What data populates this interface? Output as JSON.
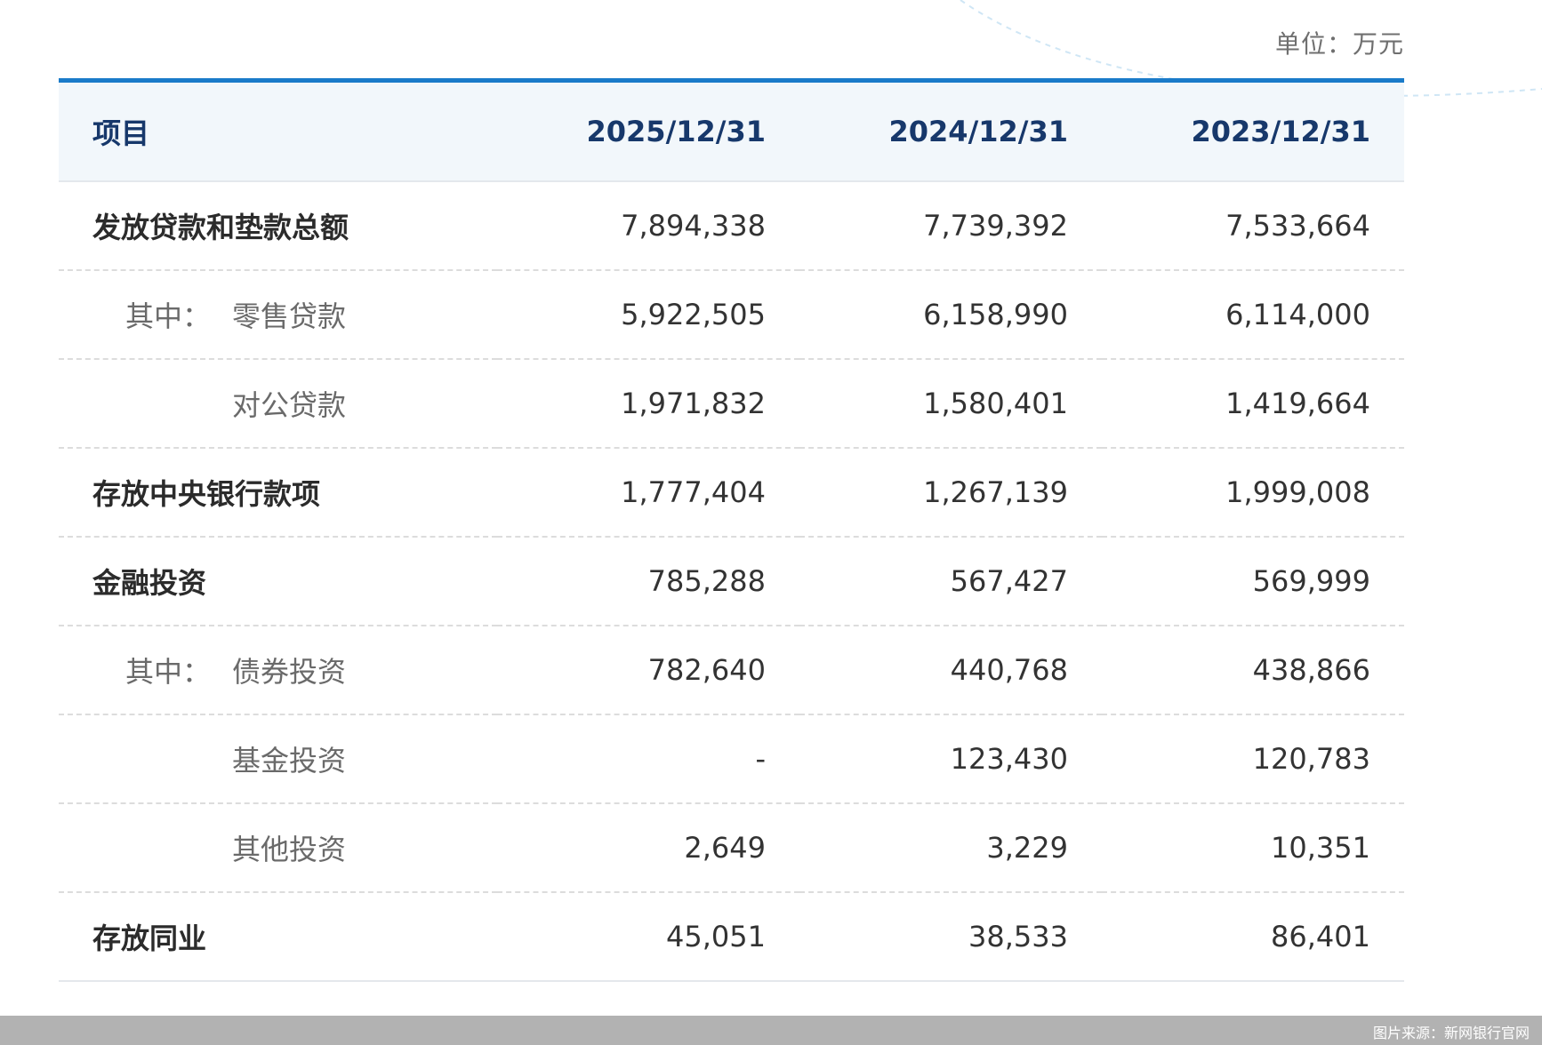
{
  "unit_label": "单位：万元",
  "header": {
    "item": "项目",
    "col1": "2025/12/31",
    "col2": "2024/12/31",
    "col3": "2023/12/31"
  },
  "rows": [
    {
      "prefix": "",
      "name": "发放贷款和垫款总额",
      "v1": "7,894,338",
      "v2": "7,739,392",
      "v3": "7,533,664"
    },
    {
      "prefix": "其中：",
      "name": "零售贷款",
      "v1": "5,922,505",
      "v2": "6,158,990",
      "v3": "6,114,000"
    },
    {
      "prefix": "",
      "name": "对公贷款",
      "v1": "1,971,832",
      "v2": "1,580,401",
      "v3": "1,419,664"
    },
    {
      "prefix": "",
      "name": "存放中央银行款项",
      "v1": "1,777,404",
      "v2": "1,267,139",
      "v3": "1,999,008"
    },
    {
      "prefix": "",
      "name": "金融投资",
      "v1": "785,288",
      "v2": "567,427",
      "v3": "569,999"
    },
    {
      "prefix": "其中：",
      "name": "债券投资",
      "v1": "782,640",
      "v2": "440,768",
      "v3": "438,866"
    },
    {
      "prefix": "",
      "name": "基金投资",
      "v1": "-",
      "v2": "123,430",
      "v3": "120,783"
    },
    {
      "prefix": "",
      "name": "其他投资",
      "v1": "2,649",
      "v2": "3,229",
      "v3": "10,351"
    },
    {
      "prefix": "",
      "name": "存放同业",
      "v1": "45,051",
      "v2": "38,533",
      "v3": "86,401"
    }
  ],
  "footer": {
    "source": "图片来源：新网银行官网"
  },
  "colors": {
    "accent": "#1a7bc9",
    "header_text": "#17386b",
    "header_bg": "#f2f7fb",
    "footer_bg": "#b2b2b2"
  }
}
